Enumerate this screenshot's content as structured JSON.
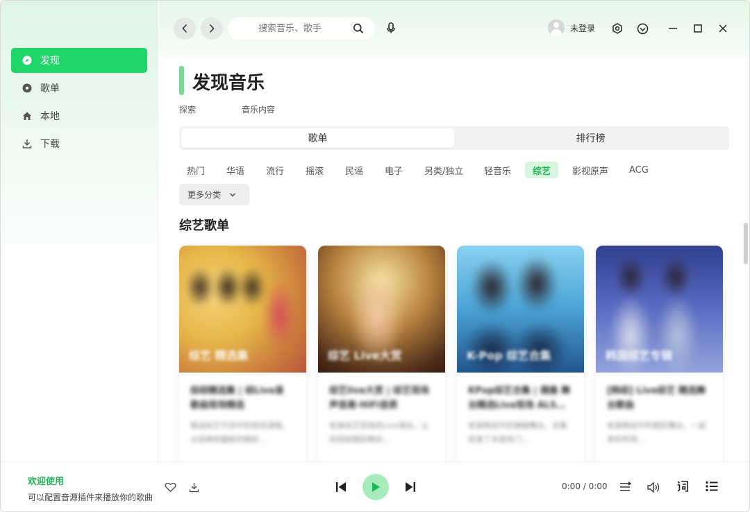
{
  "sidebar": {
    "items": [
      {
        "label": "发现",
        "icon": "compass-icon",
        "active": true
      },
      {
        "label": "歌单",
        "icon": "disc-icon",
        "active": false
      },
      {
        "label": "本地",
        "icon": "home-icon",
        "active": false
      },
      {
        "label": "下载",
        "icon": "download-icon",
        "active": false
      }
    ]
  },
  "header": {
    "search_placeholder": "搜索音乐、歌手",
    "user_label": "未登录"
  },
  "main": {
    "page_title": "发现音乐",
    "subtitles": [
      "探索",
      "音乐内容"
    ],
    "tabs": [
      {
        "label": "歌单",
        "active": true
      },
      {
        "label": "排行榜",
        "active": false
      }
    ],
    "tags": [
      "热门",
      "华语",
      "流行",
      "摇滚",
      "民谣",
      "电子",
      "另类/独立",
      "轻音乐",
      "综艺",
      "影视原声",
      "ACG"
    ],
    "active_tag": "综艺",
    "more_label": "更多分类",
    "section_title": "综艺歌单",
    "cards": [
      {
        "cover_label": "综艺 精选集",
        "title": "综综精选集 | 综Live录 歌曲现场精选",
        "desc": "精选综艺节目中的现场演唱，从经典到最新的精彩…"
      },
      {
        "cover_label": "综艺 Live大赏",
        "title": "综艺live大赏 | 综艺现场 声音高·HiFi音质",
        "desc": "收录综艺现场的Live演出，让你回味精彩瞬间…"
      },
      {
        "cover_label": "K-Pop 综艺合集",
        "title": "KPop综艺合集 | 偶像 舞台精选Live现场 ALS…",
        "desc": "收录韩综中的偶像舞台，合集收录了多首热门…"
      },
      {
        "cover_label": "韩国综艺专辑",
        "title": "[韩综] Live综艺 精选舞台歌曲",
        "desc": "收录韩综中的精彩舞台，一起来听听吧…"
      }
    ]
  },
  "player": {
    "welcome_title": "欢迎使用",
    "welcome_sub": "可以配置音源插件来播放你的歌曲",
    "time": "0:00 / 0:00"
  },
  "colors": {
    "accent": "#20d56a",
    "accent_light": "#a8ecbd"
  }
}
